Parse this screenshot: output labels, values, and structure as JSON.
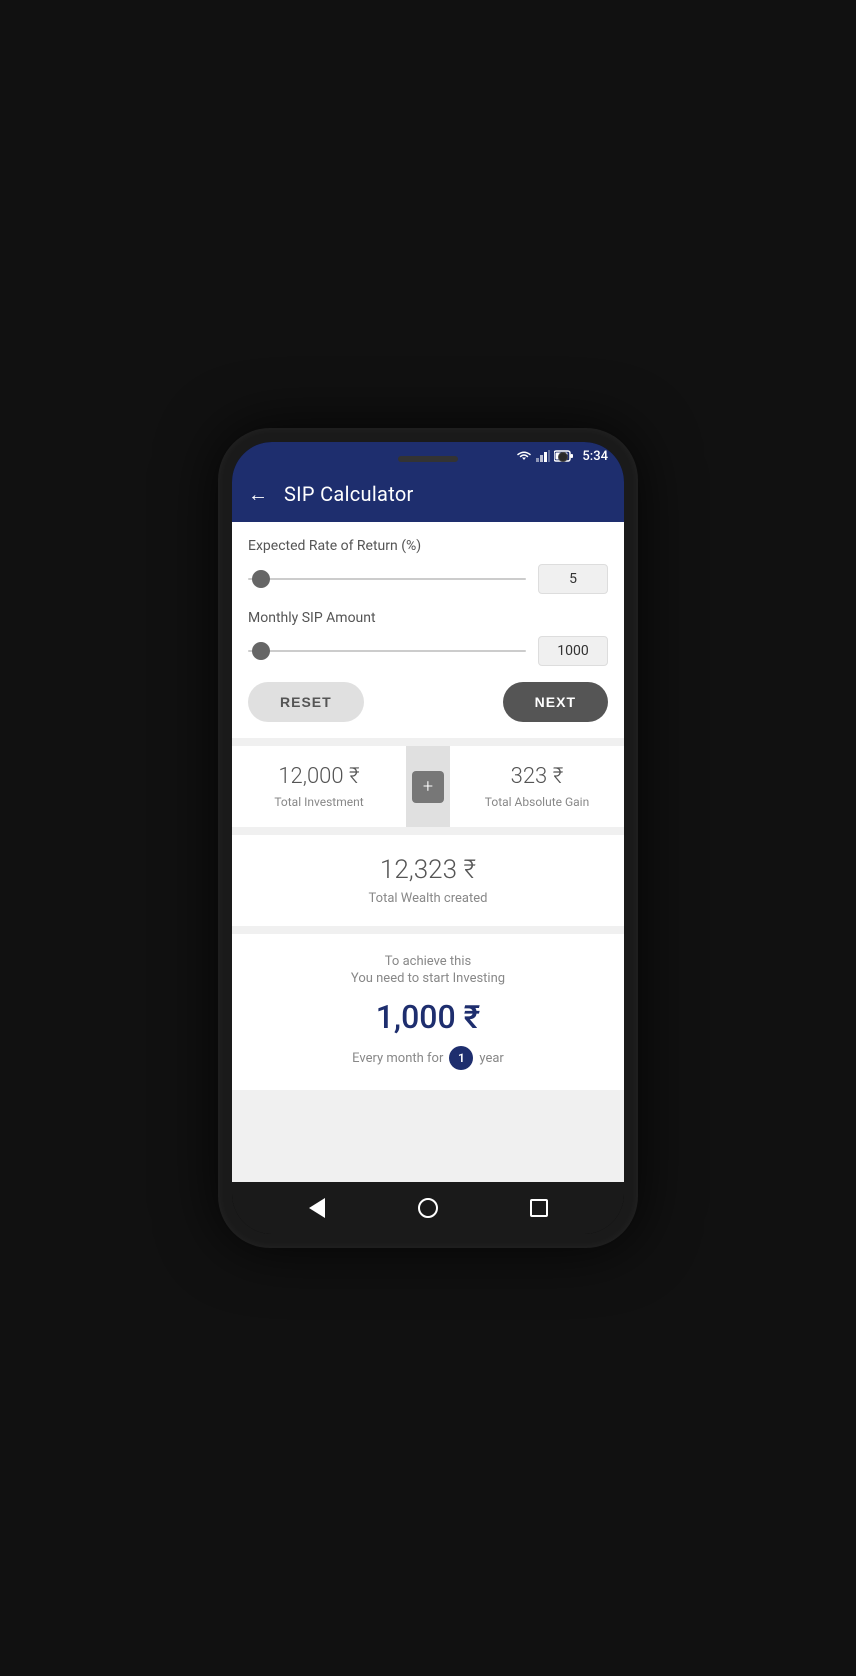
{
  "status_bar": {
    "time": "5:34"
  },
  "app_bar": {
    "back_label": "←",
    "title": "SIP Calculator"
  },
  "calculator": {
    "rate_label": "Expected Rate of Return (%)",
    "rate_value": "5",
    "sip_label": "Monthly SIP Amount",
    "sip_value": "1000",
    "reset_label": "RESET",
    "next_label": "NEXT"
  },
  "summary": {
    "total_investment_value": "12,000 ₹",
    "total_investment_label": "Total Investment",
    "plus_icon": "+",
    "total_gain_value": "323 ₹",
    "total_gain_label": "Total Absolute Gain",
    "total_wealth_value": "12,323 ₹",
    "total_wealth_label": "Total Wealth created",
    "achieve_line1": "To achieve this",
    "achieve_line2": "You need to start Investing",
    "achieve_amount": "1,000 ₹",
    "period_prefix": "Every month for",
    "period_years": "1",
    "period_suffix": "year"
  }
}
